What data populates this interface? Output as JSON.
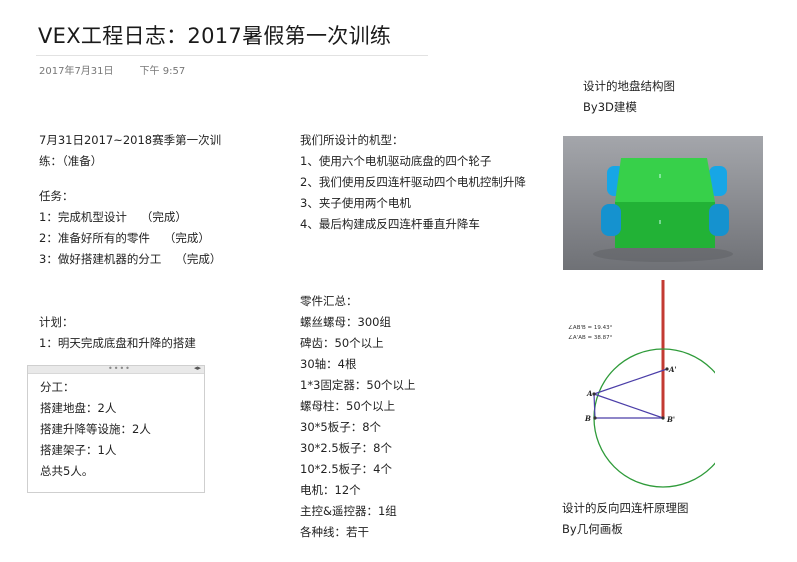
{
  "header": {
    "title": "VEX工程日志：2017暑假第一次训练",
    "date": "2017年7月31日",
    "time": "下午 9:57"
  },
  "left": {
    "heading_line1": "7月31日2017~2018赛季第一次训",
    "heading_line2": "练：（准备）",
    "tasks_title": "任务：",
    "tasks": [
      {
        "text": "1：完成机型设计",
        "status": "（完成）"
      },
      {
        "text": "2：准备好所有的零件",
        "status": "（完成）"
      },
      {
        "text": "3：做好搭建机器的分工",
        "status": "（完成）"
      }
    ],
    "plan_title": "计划：",
    "plan_item": "1：明天完成底盘和升降的搭建"
  },
  "division_box": {
    "title": "分工：",
    "lines": [
      "搭建地盘：2人",
      "搭建升降等设施：2人",
      "搭建架子：1人",
      "总共5人。"
    ]
  },
  "middle": {
    "design_title": "我们所设计的机型：",
    "design_items": [
      "1、使用六个电机驱动底盘的四个轮子",
      "2、我们使用反四连杆驱动四个电机控制升降",
      "3、夹子使用两个电机",
      "4、最后构建成反四连杆垂直升降车"
    ],
    "parts_title": "零件汇总：",
    "parts": [
      "螺丝螺母：300组",
      "碑齿：50个以上",
      "30轴：4根",
      "1*3固定器：50个以上",
      "螺母柱：50个以上",
      "30*5板子：8个",
      "30*2.5板子：8个",
      "10*2.5板子：4个",
      "电机：12个",
      "主控&遥控器：1组",
      "各种线：若干"
    ]
  },
  "right": {
    "chassis_caption1": "设计的地盘结构图",
    "chassis_caption2": "By3D建模",
    "linkage_caption1": "设计的反向四连杆原理图",
    "linkage_caption2": "By几何画板",
    "angle_label1": "∠AB'B = 19.43°",
    "angle_label2": "∠A'AB = 38.87°",
    "point_A": "A",
    "point_A_prime": "A'",
    "point_B": "B",
    "point_B_prime": "B'"
  }
}
